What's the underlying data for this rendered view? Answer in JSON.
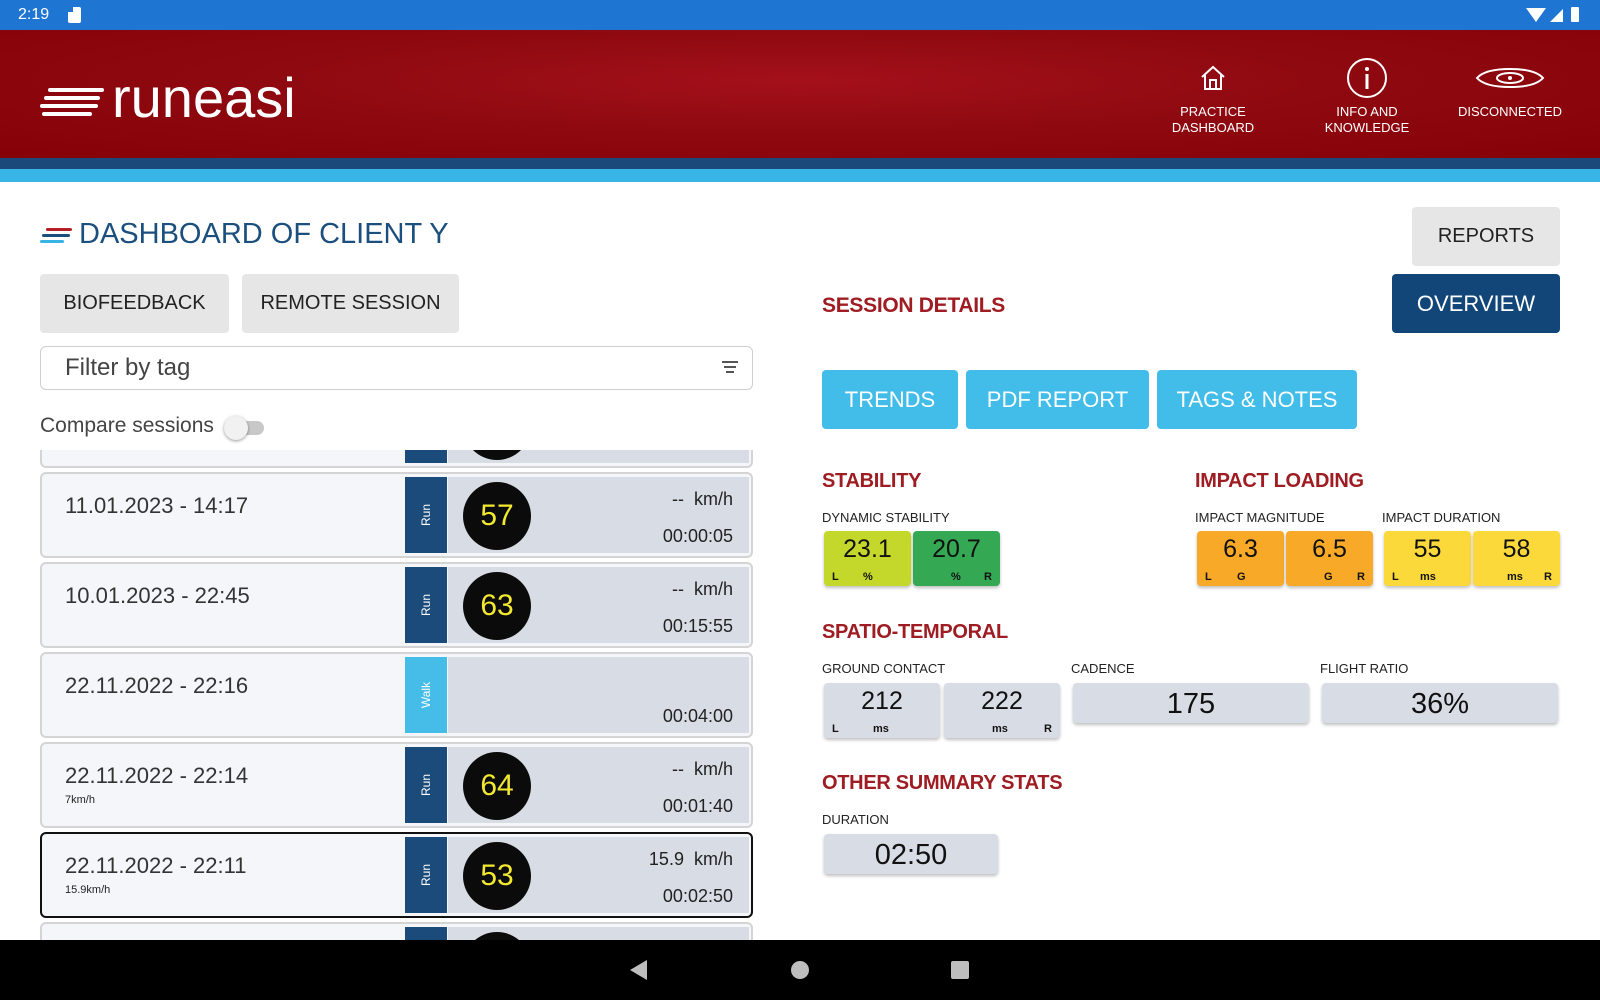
{
  "status_bar": {
    "time": "2:19"
  },
  "header": {
    "logo_text": "runeasi",
    "nav": [
      {
        "label": "PRACTICE\nDASHBOARD",
        "icon": "home-icon"
      },
      {
        "label": "INFO AND\nKNOWLEDGE",
        "icon": "info-icon"
      },
      {
        "label": "DISCONNECTED",
        "icon": "sensor-icon"
      }
    ]
  },
  "page": {
    "title": "DASHBOARD OF CLIENT Y",
    "reports_button": "REPORTS",
    "biofeedback_button": "BIOFEEDBACK",
    "remote_session_button": "REMOTE SESSION",
    "filter_placeholder": "Filter by tag",
    "compare_label": "Compare sessions",
    "compare_enabled": false
  },
  "sessions": [
    {
      "date": "11.01.2023 - 14:17",
      "sub": "",
      "type": "Run",
      "score": "57",
      "speed": "--",
      "unit": "km/h",
      "duration": "00:00:05",
      "selected": false
    },
    {
      "date": "10.01.2023 - 22:45",
      "sub": "",
      "type": "Run",
      "score": "63",
      "speed": "--",
      "unit": "km/h",
      "duration": "00:15:55",
      "selected": false
    },
    {
      "date": "22.11.2022 - 22:16",
      "sub": "",
      "type": "Walk",
      "score": "",
      "speed": "",
      "unit": "",
      "duration": "00:04:00",
      "selected": false
    },
    {
      "date": "22.11.2022 - 22:14",
      "sub": "7km/h",
      "type": "Run",
      "score": "64",
      "speed": "--",
      "unit": "km/h",
      "duration": "00:01:40",
      "selected": false
    },
    {
      "date": "22.11.2022 - 22:11",
      "sub": "15.9km/h",
      "type": "Run",
      "score": "53",
      "speed": "15.9",
      "unit": "km/h",
      "duration": "00:02:50",
      "selected": true
    }
  ],
  "details": {
    "title": "SESSION DETAILS",
    "overview_button": "OVERVIEW",
    "trends_button": "TRENDS",
    "pdf_report_button": "PDF REPORT",
    "tags_notes_button": "TAGS & NOTES",
    "stability": {
      "title": "STABILITY",
      "dynamic_label": "DYNAMIC STABILITY",
      "left": {
        "value": "23.1",
        "side": "L",
        "unit": "%",
        "color": "#c3d82a"
      },
      "right": {
        "value": "20.7",
        "side": "R",
        "unit": "%",
        "color": "#34a853"
      }
    },
    "impact": {
      "title": "IMPACT LOADING",
      "magnitude_label": "IMPACT MAGNITUDE",
      "duration_label": "IMPACT DURATION",
      "mag_left": {
        "value": "6.3",
        "side": "L",
        "unit": "G",
        "color": "#f8a928"
      },
      "mag_right": {
        "value": "6.5",
        "side": "R",
        "unit": "G",
        "color": "#f8a928"
      },
      "dur_left": {
        "value": "55",
        "side": "L",
        "unit": "ms",
        "color": "#fbd93a"
      },
      "dur_right": {
        "value": "58",
        "side": "R",
        "unit": "ms",
        "color": "#fbd93a"
      }
    },
    "spatio": {
      "title": "SPATIO-TEMPORAL",
      "ground_contact_label": "GROUND CONTACT",
      "cadence_label": "CADENCE",
      "flight_ratio_label": "FLIGHT RATIO",
      "gc_left": {
        "value": "212",
        "side": "L",
        "unit": "ms"
      },
      "gc_right": {
        "value": "222",
        "side": "R",
        "unit": "ms"
      },
      "cadence": "175",
      "flight_ratio": "36%"
    },
    "other": {
      "title": "OTHER SUMMARY STATS",
      "duration_label": "DURATION",
      "duration": "02:50"
    }
  },
  "colors": {
    "header_red": "#8f0a10",
    "brand_navy": "#124678",
    "accent_blue": "#42bde9",
    "section_red": "#9e1c22"
  }
}
